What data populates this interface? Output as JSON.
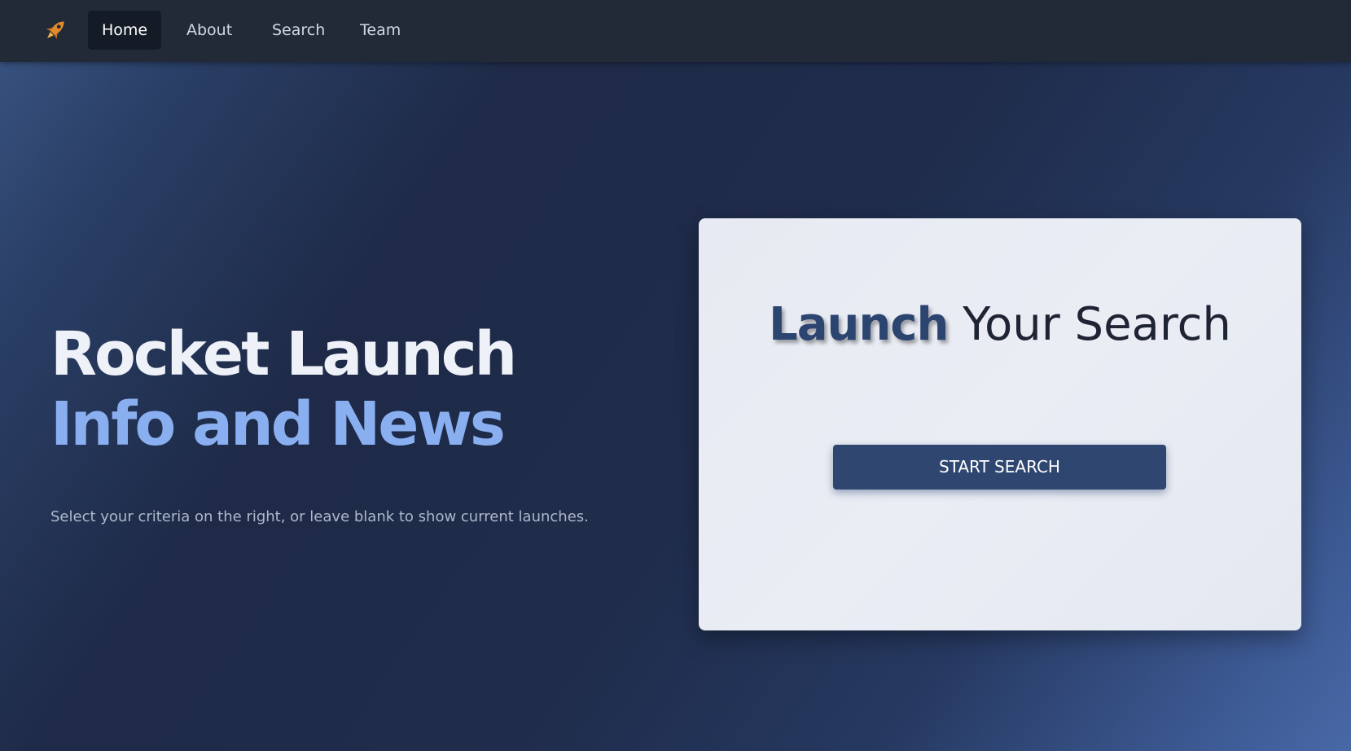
{
  "nav": {
    "logo_icon": "rocket-icon",
    "items": [
      {
        "label": "Home",
        "active": true
      },
      {
        "label": "About",
        "active": false
      },
      {
        "label": "Search",
        "active": false
      },
      {
        "label": "Team",
        "active": false
      }
    ]
  },
  "hero": {
    "title_line1": "Rocket Launch",
    "title_line2": "Info and News",
    "subtitle": "Select your criteria on the right, or leave blank to show current launches."
  },
  "card": {
    "title_strong": "Launch",
    "title_rest": "Your Search",
    "button_label": "START SEARCH"
  },
  "colors": {
    "accent": "#8aaff0",
    "button": "#2e4670",
    "navbar": "#222a38",
    "rocket": "#e08a2c"
  }
}
